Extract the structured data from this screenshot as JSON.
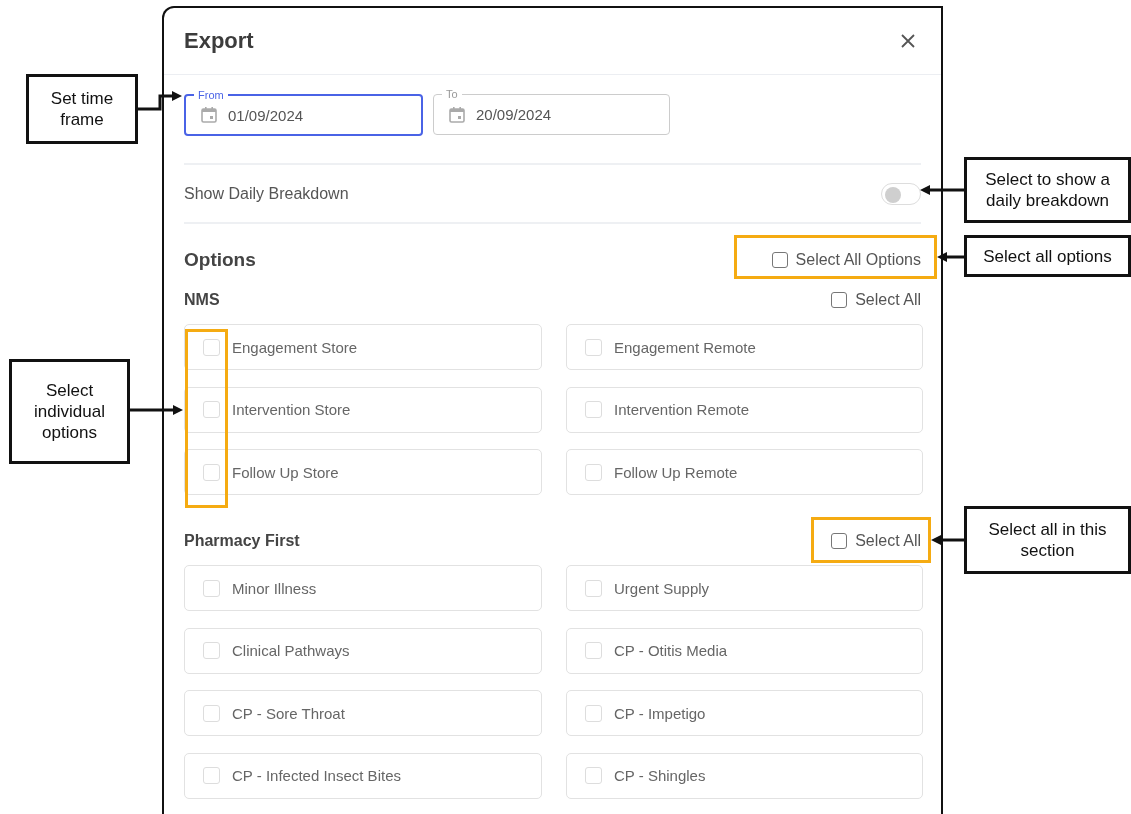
{
  "dialog": {
    "title": "Export",
    "date_range": [
      {
        "label": "From",
        "value": "01/09/2024",
        "focused": true
      },
      {
        "label": "To",
        "value": "20/09/2024",
        "focused": false
      }
    ],
    "daily_breakdown": {
      "label": "Show Daily Breakdown",
      "on": false
    },
    "options_title": "Options",
    "select_all_options": {
      "label": "Select All Options",
      "checked": false
    },
    "sections": [
      {
        "title": "NMS",
        "select_all": {
          "label": "Select All",
          "checked": false
        },
        "options": [
          {
            "label": "Engagement Store",
            "checked": false
          },
          {
            "label": "Engagement Remote",
            "checked": false
          },
          {
            "label": "Intervention Store",
            "checked": false
          },
          {
            "label": "Intervention Remote",
            "checked": false
          },
          {
            "label": "Follow Up Store",
            "checked": false
          },
          {
            "label": "Follow Up Remote",
            "checked": false
          }
        ]
      },
      {
        "title": "Pharmacy First",
        "select_all": {
          "label": "Select All",
          "checked": false
        },
        "options": [
          {
            "label": "Minor Illness",
            "checked": false
          },
          {
            "label": "Urgent Supply",
            "checked": false
          },
          {
            "label": "Clinical Pathways",
            "checked": false
          },
          {
            "label": "CP - Otitis Media",
            "checked": false
          },
          {
            "label": "CP - Sore Throat",
            "checked": false
          },
          {
            "label": "CP - Impetigo",
            "checked": false
          },
          {
            "label": "CP - Infected Insect Bites",
            "checked": false
          },
          {
            "label": "CP - Shingles",
            "checked": false
          }
        ]
      }
    ]
  },
  "annotations": [
    {
      "text": "Set time frame"
    },
    {
      "text": "Select to show a daily breakdown"
    },
    {
      "text": "Select all options"
    },
    {
      "text": "Select individual options"
    },
    {
      "text": "Select all in this section"
    }
  ]
}
